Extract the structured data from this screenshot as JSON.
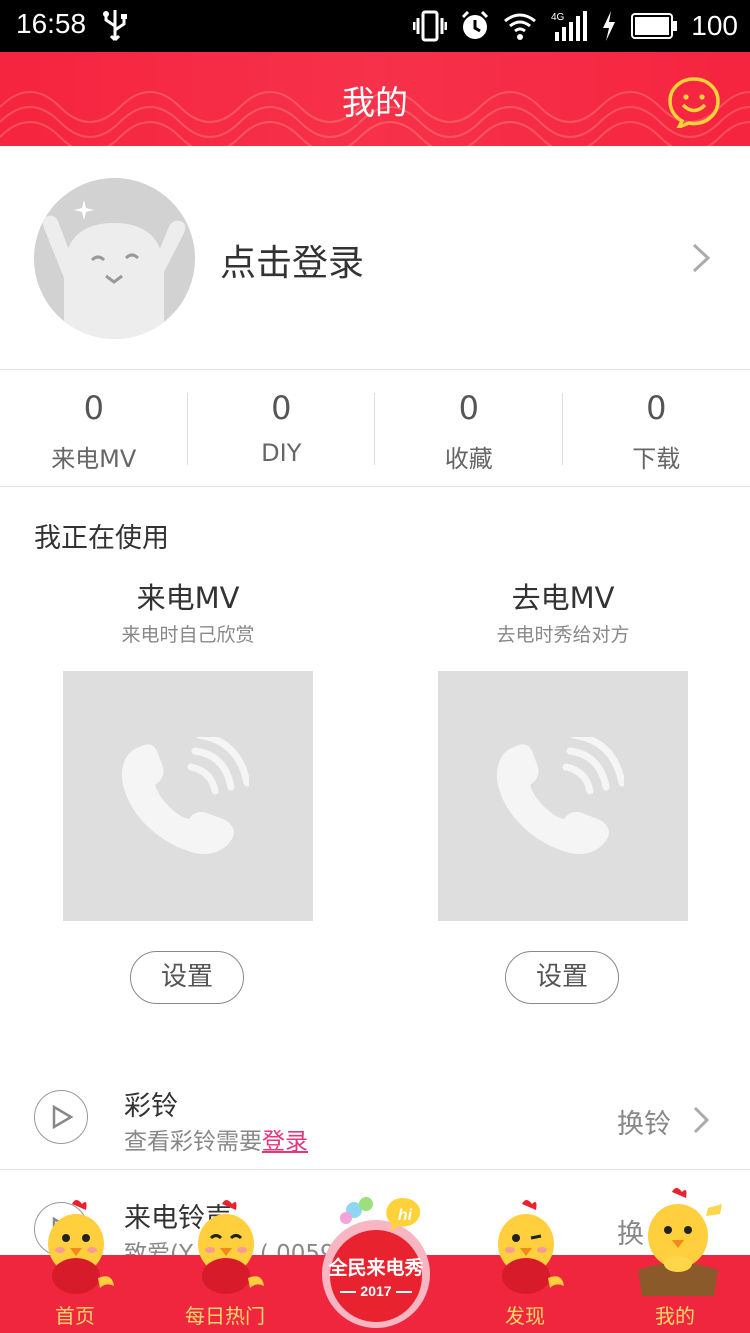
{
  "status_bar": {
    "time": "16:58",
    "battery": "100",
    "network": "4G",
    "icons": [
      "usb-icon",
      "vibrate-icon",
      "alarm-icon",
      "wifi-icon",
      "signal-icon",
      "charging-icon",
      "battery-icon"
    ]
  },
  "header": {
    "title": "我的",
    "right_icon": "smile-face-icon",
    "accent_color": "#f5243f"
  },
  "profile": {
    "login_text": "点击登录"
  },
  "stats": [
    {
      "value": "0",
      "label": "来电MV"
    },
    {
      "value": "0",
      "label": "DIY"
    },
    {
      "value": "0",
      "label": "收藏"
    },
    {
      "value": "0",
      "label": "下载"
    }
  ],
  "in_use": {
    "title": "我正在使用",
    "items": [
      {
        "title": "来电MV",
        "subtitle": "来电时自己欣赏",
        "button": "设置"
      },
      {
        "title": "去电MV",
        "subtitle": "去电时秀给对方",
        "button": "设置"
      }
    ]
  },
  "list": [
    {
      "title": "彩铃",
      "subtitle_prefix": "查看彩铃需要",
      "subtitle_link": "登录",
      "right": "换铃"
    },
    {
      "title": "来电铃声",
      "subtitle": "致爱(Y     ong) (     0059",
      "right": "换"
    }
  ],
  "tabbar": {
    "tabs": [
      {
        "label": "首页"
      },
      {
        "label": "每日热门"
      },
      {
        "label": "全民来电秀"
      },
      {
        "label": "发现"
      },
      {
        "label": "我的"
      }
    ],
    "badge_text": "全民来电秀",
    "badge_year": "2017",
    "badge_hi": "hi",
    "label_color": "#ffd76a"
  }
}
